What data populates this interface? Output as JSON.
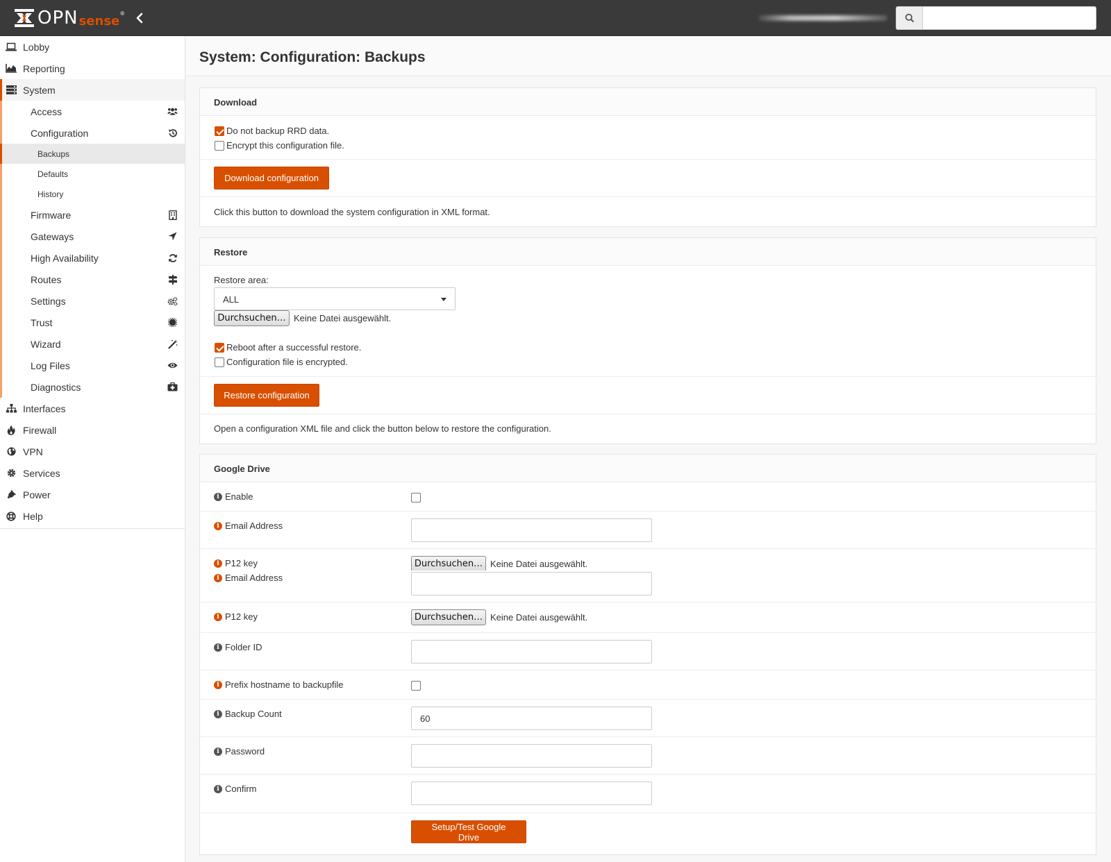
{
  "header": {
    "logo_primary": "OPN",
    "logo_secondary": "sense",
    "logo_mark": "®",
    "search_placeholder": ""
  },
  "sidebar": {
    "items": [
      {
        "label": "Lobby",
        "icon": "laptop-icon"
      },
      {
        "label": "Reporting",
        "icon": "area-chart-icon"
      },
      {
        "label": "System",
        "icon": "server-icon"
      },
      {
        "label": "Interfaces",
        "icon": "sitemap-icon"
      },
      {
        "label": "Firewall",
        "icon": "fire-icon"
      },
      {
        "label": "VPN",
        "icon": "globe-icon"
      },
      {
        "label": "Services",
        "icon": "cog-icon"
      },
      {
        "label": "Power",
        "icon": "plug-icon"
      },
      {
        "label": "Help",
        "icon": "life-ring-icon"
      }
    ],
    "system_children": [
      {
        "label": "Access",
        "icon": "users-icon"
      },
      {
        "label": "Configuration",
        "icon": "history-icon"
      },
      {
        "label": "Firmware",
        "icon": "building-icon"
      },
      {
        "label": "Gateways",
        "icon": "location-arrow-icon"
      },
      {
        "label": "High Availability",
        "icon": "refresh-icon"
      },
      {
        "label": "Routes",
        "icon": "map-signs-icon"
      },
      {
        "label": "Settings",
        "icon": "cogs-icon"
      },
      {
        "label": "Trust",
        "icon": "certificate-icon"
      },
      {
        "label": "Wizard",
        "icon": "magic-icon"
      },
      {
        "label": "Log Files",
        "icon": "eye-icon"
      },
      {
        "label": "Diagnostics",
        "icon": "medkit-icon"
      }
    ],
    "configuration_children": [
      "Backups",
      "Defaults",
      "History"
    ]
  },
  "page": {
    "title": "System: Configuration: Backups"
  },
  "download": {
    "title": "Download",
    "no_rrd_label": "Do not backup RRD data.",
    "no_rrd_checked": true,
    "encrypt_label": "Encrypt this configuration file.",
    "encrypt_checked": false,
    "button": "Download configuration",
    "help": "Click this button to download the system configuration in XML format."
  },
  "restore": {
    "title": "Restore",
    "area_label": "Restore area:",
    "area_value": "ALL",
    "file_button": "Durchsuchen…",
    "file_note": "Keine Datei ausgewählt.",
    "reboot_label": "Reboot after a successful restore.",
    "reboot_checked": true,
    "encrypted_label": "Configuration file is encrypted.",
    "encrypted_checked": false,
    "button": "Restore configuration",
    "help": "Open a configuration XML file and click the button below to restore the configuration."
  },
  "gdrive": {
    "title": "Google Drive",
    "enable_label": "Enable",
    "email_label": "Email Address",
    "p12_label": "P12 key",
    "file_button": "Durchsuchen…",
    "file_note": "Keine Datei ausgewählt.",
    "folder_label": "Folder ID",
    "prefix_label": "Prefix hostname to backupfile",
    "count_label": "Backup Count",
    "count_value": "60",
    "password_label": "Password",
    "confirm_label": "Confirm",
    "button": "Setup/Test Google Drive"
  },
  "colors": {
    "accent": "#d94f00",
    "topbar": "#3a3a3a"
  }
}
